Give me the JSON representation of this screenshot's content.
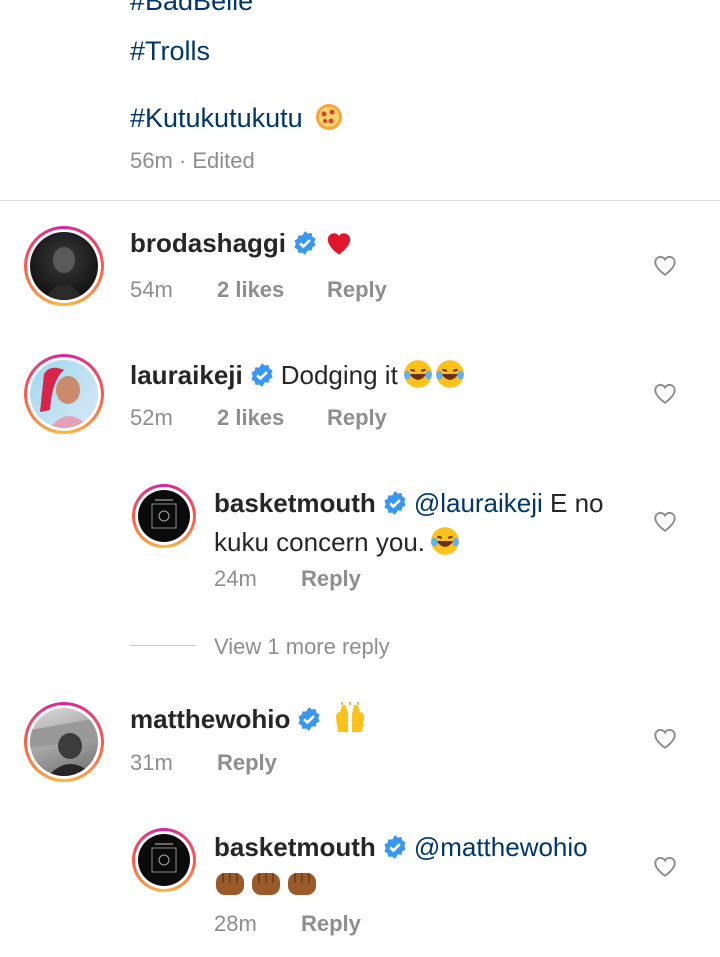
{
  "caption": {
    "partial_tag": "#BadBelle",
    "tag1": "#Trolls",
    "tag2": "#Kutukutukutu",
    "meta": "56m · Edited"
  },
  "comments": [
    {
      "username": "brodashaggi",
      "text": "",
      "time": "54m",
      "likes": "2 likes",
      "reply": "Reply"
    },
    {
      "username": "lauraikeji",
      "text": "Dodging it",
      "time": "52m",
      "likes": "2 likes",
      "reply": "Reply"
    }
  ],
  "reply1": {
    "username": "basketmouth",
    "mention": "@lauraikeji",
    "text_line1": " E no",
    "text_line2": "kuku concern you.",
    "time": "24m",
    "reply": "Reply"
  },
  "view_more": "View 1 more reply",
  "comment3": {
    "username": "matthewohio",
    "time": "31m",
    "reply": "Reply"
  },
  "reply2": {
    "username": "basketmouth",
    "mention": "@matthewohio",
    "time": "28m",
    "reply": "Reply"
  },
  "colors": {
    "link": "#00376b",
    "meta": "#8e8e8e",
    "verified": "#3897f0"
  },
  "icons": [
    "verified-badge-icon",
    "heart-outline-icon",
    "red-heart-icon",
    "laugh-cry-emoji-icon",
    "raised-hands-emoji-icon",
    "fist-emoji-icon",
    "pizza-emoji-icon"
  ]
}
